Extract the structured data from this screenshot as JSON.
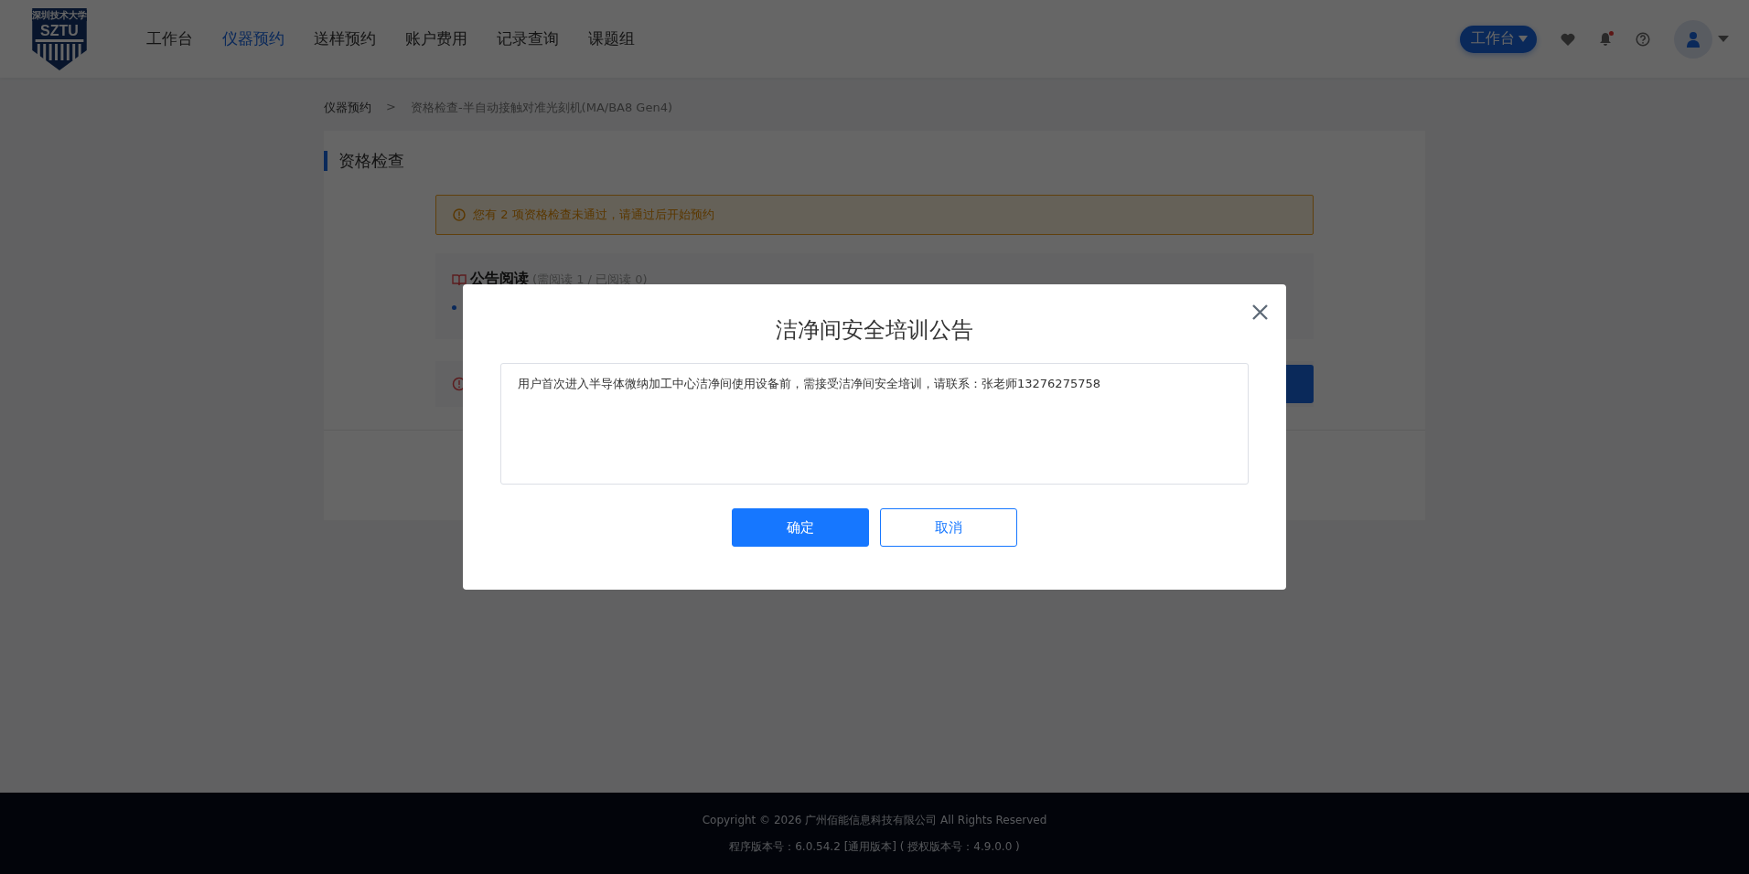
{
  "header": {
    "logo": {
      "name": "深圳技术大学",
      "abbr": "SZTU"
    },
    "nav": [
      {
        "label": "工作台",
        "selected": false
      },
      {
        "label": "仪器预约",
        "selected": true
      },
      {
        "label": "送样预约",
        "selected": false
      },
      {
        "label": "账户费用",
        "selected": false
      },
      {
        "label": "记录查询",
        "selected": false
      },
      {
        "label": "课题组",
        "selected": false
      }
    ],
    "workbench_button": "工作台",
    "has_unread": true
  },
  "breadcrumb": {
    "items": [
      "仪器预约",
      "资格检查-半自动接触对准光刻机(MA/BA8 Gen4)"
    ],
    "separator": ">"
  },
  "card": {
    "title": "资格检查",
    "warning": "您有 2 项资格检查未通过，请通过后开始预约",
    "notice": {
      "title": "公告阅读",
      "count": "(需阅读 1 / 已阅读 0)"
    }
  },
  "dialog": {
    "title": "洁净间安全培训公告",
    "body": "用户首次进入半导体微纳加工中心洁净间使用设备前，需接受洁净间安全培训，请联系：张老师13276275758",
    "buttons": [
      {
        "label": "确定",
        "kind": "primary"
      },
      {
        "label": "取消",
        "kind": "default"
      }
    ]
  },
  "footer": {
    "copyright": "Copyright © 2026 广州佰能信息科技有限公司 All Rights Reserved",
    "version": "程序版本号：6.0.54.2 [通用版本] ( 授权版本号：4.9.0.0 )"
  }
}
